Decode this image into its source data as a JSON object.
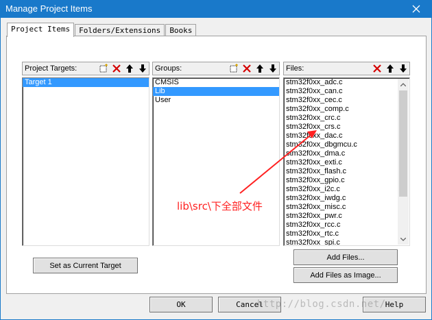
{
  "window": {
    "title": "Manage Project Items"
  },
  "tabs": [
    {
      "label": "Project Items",
      "active": true
    },
    {
      "label": "Folders/Extensions",
      "active": false
    },
    {
      "label": "Books",
      "active": false
    }
  ],
  "targets": {
    "header": "Project Targets:",
    "items": [
      {
        "label": "Target 1",
        "selected": true
      }
    ]
  },
  "groups": {
    "header": "Groups:",
    "items": [
      {
        "label": "CMSIS",
        "selected": false
      },
      {
        "label": "Lib",
        "selected": true
      },
      {
        "label": "User",
        "selected": false
      }
    ]
  },
  "files": {
    "header": "Files:",
    "items": [
      "stm32f0xx_adc.c",
      "stm32f0xx_can.c",
      "stm32f0xx_cec.c",
      "stm32f0xx_comp.c",
      "stm32f0xx_crc.c",
      "stm32f0xx_crs.c",
      "stm32f0xx_dac.c",
      "stm32f0xx_dbgmcu.c",
      "stm32f0xx_dma.c",
      "stm32f0xx_exti.c",
      "stm32f0xx_flash.c",
      "stm32f0xx_gpio.c",
      "stm32f0xx_i2c.c",
      "stm32f0xx_iwdg.c",
      "stm32f0xx_misc.c",
      "stm32f0xx_pwr.c",
      "stm32f0xx_rcc.c",
      "stm32f0xx_rtc.c",
      "stm32f0xx_spi.c"
    ]
  },
  "buttons": {
    "set_current_target": "Set as Current Target",
    "add_files": "Add Files...",
    "add_files_as_image": "Add Files as Image...",
    "ok": "OK",
    "cancel": "Cancel",
    "help": "Help"
  },
  "annotation": {
    "text": "lib\\src\\下全部文件",
    "color": "#ff2020"
  },
  "watermark": "http://blog.csdn.net/",
  "colors": {
    "titlebar": "#1979ca",
    "selection": "#3399ff",
    "delete_icon": "#d40000"
  }
}
